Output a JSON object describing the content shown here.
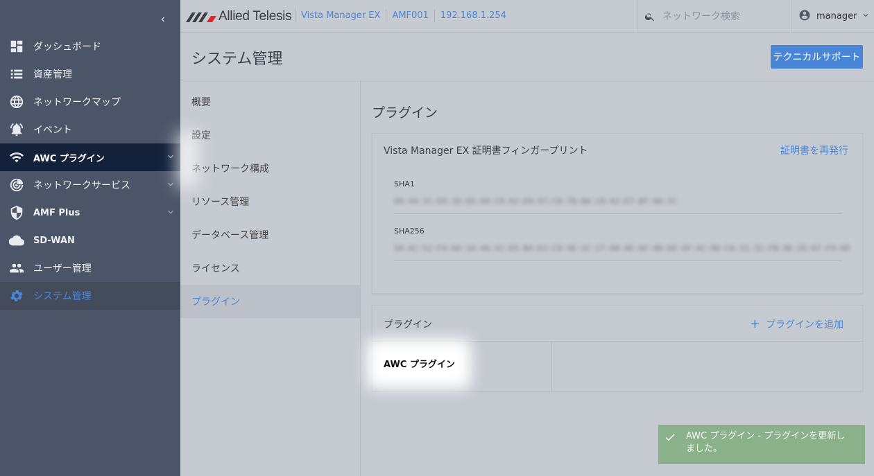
{
  "sidebar": {
    "items": [
      {
        "label": "ダッシュボード",
        "icon": "dashboard-icon"
      },
      {
        "label": "資産管理",
        "icon": "list-icon"
      },
      {
        "label": "ネットワークマップ",
        "icon": "globe-icon"
      },
      {
        "label": "イベント",
        "icon": "bell-icon"
      },
      {
        "label": "AWC プラグイン",
        "icon": "wifi-icon"
      },
      {
        "label": "ネットワークサービス",
        "icon": "radar-icon"
      },
      {
        "label": "AMF Plus",
        "icon": "shield-icon"
      },
      {
        "label": "SD-WAN",
        "icon": "cloud-icon"
      },
      {
        "label": "ユーザー管理",
        "icon": "users-icon"
      },
      {
        "label": "システム管理",
        "icon": "gear-icon"
      }
    ]
  },
  "topbar": {
    "brand": "Allied Telesis",
    "crumbs": [
      "Vista Manager EX",
      "AMF001",
      "192.168.1.254"
    ],
    "search_placeholder": "ネットワーク検索",
    "user": "manager"
  },
  "header": {
    "title": "システム管理",
    "support_button": "テクニカルサポート"
  },
  "subnav": {
    "items": [
      "概要",
      "設定",
      "ネットワーク構成",
      "リソース管理",
      "データベース管理",
      "ライセンス",
      "プラグイン"
    ]
  },
  "main": {
    "title": "プラグイン",
    "cert_card": {
      "title": "Vista Manager EX 証明書フィンガープリント",
      "reissue": "証明書を再発行",
      "sha1_label": "SHA1",
      "sha1_value": "60:44:1C:D9:1D:EE:69:C0:A2:D9:97:C8:7B:BA:18:42:E7:BF:86:5C",
      "sha256_label": "SHA256",
      "sha256_value": "50:AC:52:F4:66:16:46:41:D5:B4:D3:C9:4E:3C:27:08:AE:AF:0D:DE:6F:AC:0D:C6:31:32:FB:4E:2E:67:F9:6D"
    },
    "plugin_card": {
      "title": "プラグイン",
      "add": "プラグインを追加",
      "plugins": [
        "AWC プラグイン"
      ]
    }
  },
  "toast": {
    "message": "AWC プラグイン - プラグインを更新しました。"
  }
}
